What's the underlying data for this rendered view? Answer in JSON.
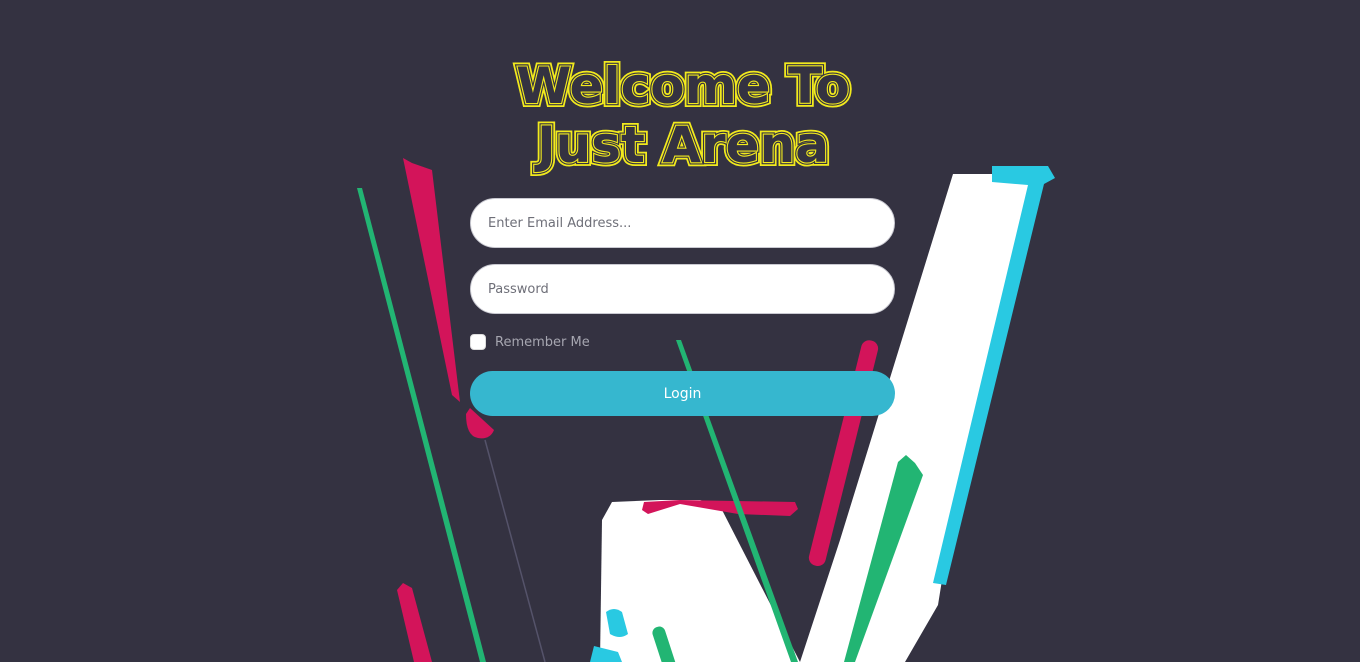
{
  "header": {
    "title_line1": "Welcome To",
    "title_line2": "Just Arena"
  },
  "form": {
    "email_placeholder": "Enter Email Address...",
    "email_value": "",
    "password_placeholder": "Password",
    "password_value": "",
    "remember_label": "Remember Me",
    "remember_checked": false,
    "login_label": "Login"
  },
  "colors": {
    "background": "#343241",
    "title": "#f2ea1d",
    "button": "#36b7cf",
    "accent_pink": "#d3145a",
    "accent_green": "#22b573",
    "accent_cyan": "#29c9e2",
    "shape_white": "#ffffff"
  }
}
